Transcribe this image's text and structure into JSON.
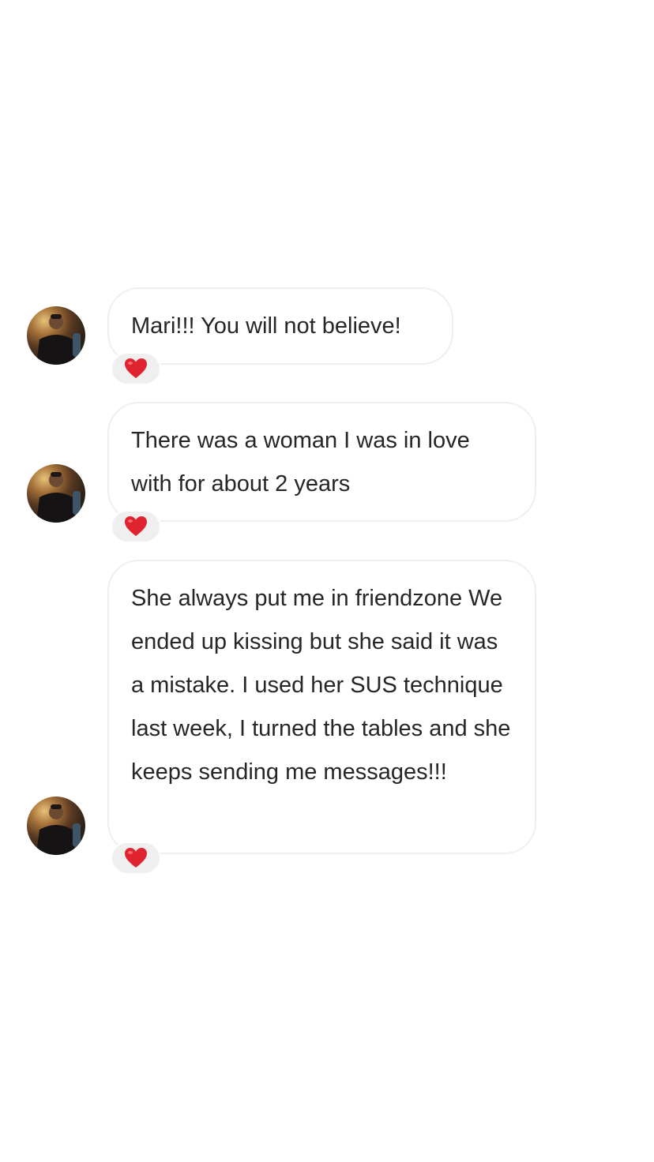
{
  "messages": [
    {
      "text": "Mari!!! You will not believe!",
      "reaction": "heart-emoji"
    },
    {
      "text": "There was a woman I was in love with for about 2 years",
      "reaction": "heart-emoji"
    },
    {
      "text": "She always put me in friendzone We ended up kissing but she said it was a mistake. I used her SUS technique last week, I turned the tables and she keeps sending me messages!!!",
      "reaction": "heart-emoji"
    }
  ],
  "colors": {
    "bubble_border": "#efefef",
    "text": "#262626",
    "reaction_bg": "#efefef",
    "heart": "#e0242f"
  }
}
